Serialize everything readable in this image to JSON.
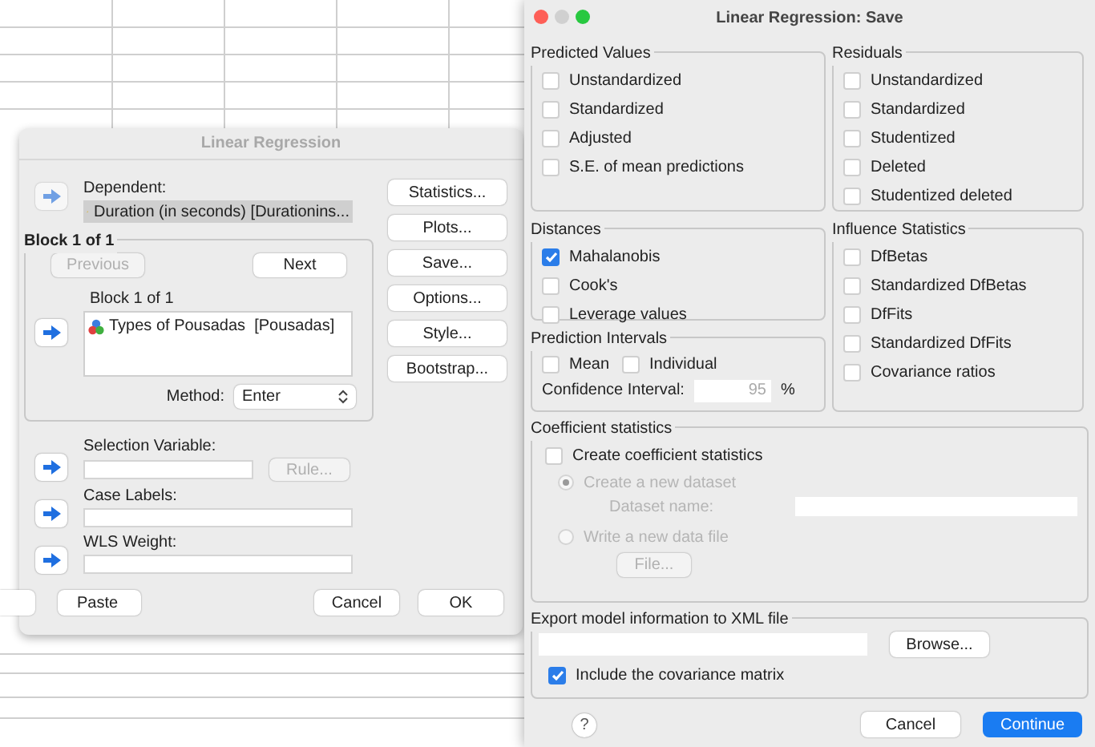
{
  "main_dialog": {
    "title": "Linear Regression",
    "dependent": {
      "label": "Dependent:",
      "value": "Duration (in seconds) [Durationins..."
    },
    "side_buttons": [
      "Statistics...",
      "Plots...",
      "Save...",
      "Options...",
      "Style...",
      "Bootstrap..."
    ],
    "block": {
      "legend": "Block 1 of 1",
      "buttons": [
        {
          "label": "Previous",
          "disabled": true
        },
        {
          "label": "Next",
          "disabled": false
        }
      ],
      "list_label": "Block 1 of 1",
      "items": [
        "Types of Pousadas  [Pousadas]"
      ],
      "method_label": "Method:",
      "method": "Enter"
    },
    "selection": {
      "label": "Selection Variable:",
      "rule_button": {
        "label": "Rule...",
        "disabled": true
      }
    },
    "case_labels": {
      "label": "Case Labels:"
    },
    "wls": {
      "label": "WLS Weight:"
    },
    "footer_buttons": [
      "Paste",
      "Cancel",
      "OK"
    ]
  },
  "save_dialog": {
    "title": "Linear Regression: Save",
    "left_groups": [
      {
        "title": "Predicted Values",
        "options": [
          {
            "label": "Unstandardized",
            "checked": false
          },
          {
            "label": "Standardized",
            "checked": false
          },
          {
            "label": "Adjusted",
            "checked": false
          },
          {
            "label": "S.E. of mean predictions",
            "checked": false
          }
        ]
      },
      {
        "title": "Distances",
        "options": [
          {
            "label": "Mahalanobis",
            "checked": true
          },
          {
            "label": "Cook's",
            "checked": false
          },
          {
            "label": "Leverage values",
            "checked": false
          }
        ]
      }
    ],
    "prediction_intervals": {
      "title": "Prediction Intervals",
      "options": [
        {
          "label": "Mean",
          "checked": false
        },
        {
          "label": "Individual",
          "checked": false
        }
      ],
      "confidence_label": "Confidence Interval:",
      "confidence_value": "95",
      "unit": "%"
    },
    "right_groups": [
      {
        "title": "Residuals",
        "options": [
          {
            "label": "Unstandardized",
            "checked": false
          },
          {
            "label": "Standardized",
            "checked": false
          },
          {
            "label": "Studentized",
            "checked": false
          },
          {
            "label": "Deleted",
            "checked": false
          },
          {
            "label": "Studentized deleted",
            "checked": false
          }
        ]
      },
      {
        "title": "Influence Statistics",
        "options": [
          {
            "label": "DfBetas",
            "checked": false
          },
          {
            "label": "Standardized DfBetas",
            "checked": false
          },
          {
            "label": "DfFits",
            "checked": false
          },
          {
            "label": "Standardized DfFits",
            "checked": false
          },
          {
            "label": "Covariance ratios",
            "checked": false
          }
        ]
      }
    ],
    "coefficient": {
      "title": "Coefficient statistics",
      "create": {
        "label": "Create coefficient statistics",
        "checked": false
      },
      "radios": [
        {
          "label": "Create a new dataset",
          "selected": true,
          "disabled": true
        },
        {
          "label": "Write a new data file",
          "selected": false,
          "disabled": true
        }
      ],
      "dataset_label": "Dataset name:",
      "file_button": "File..."
    },
    "export": {
      "title": "Export model information to XML file",
      "browse_button": "Browse...",
      "covariance": {
        "label": "Include the covariance matrix",
        "checked": true
      }
    },
    "help": "?",
    "buttons": [
      "Cancel",
      "Continue"
    ]
  }
}
